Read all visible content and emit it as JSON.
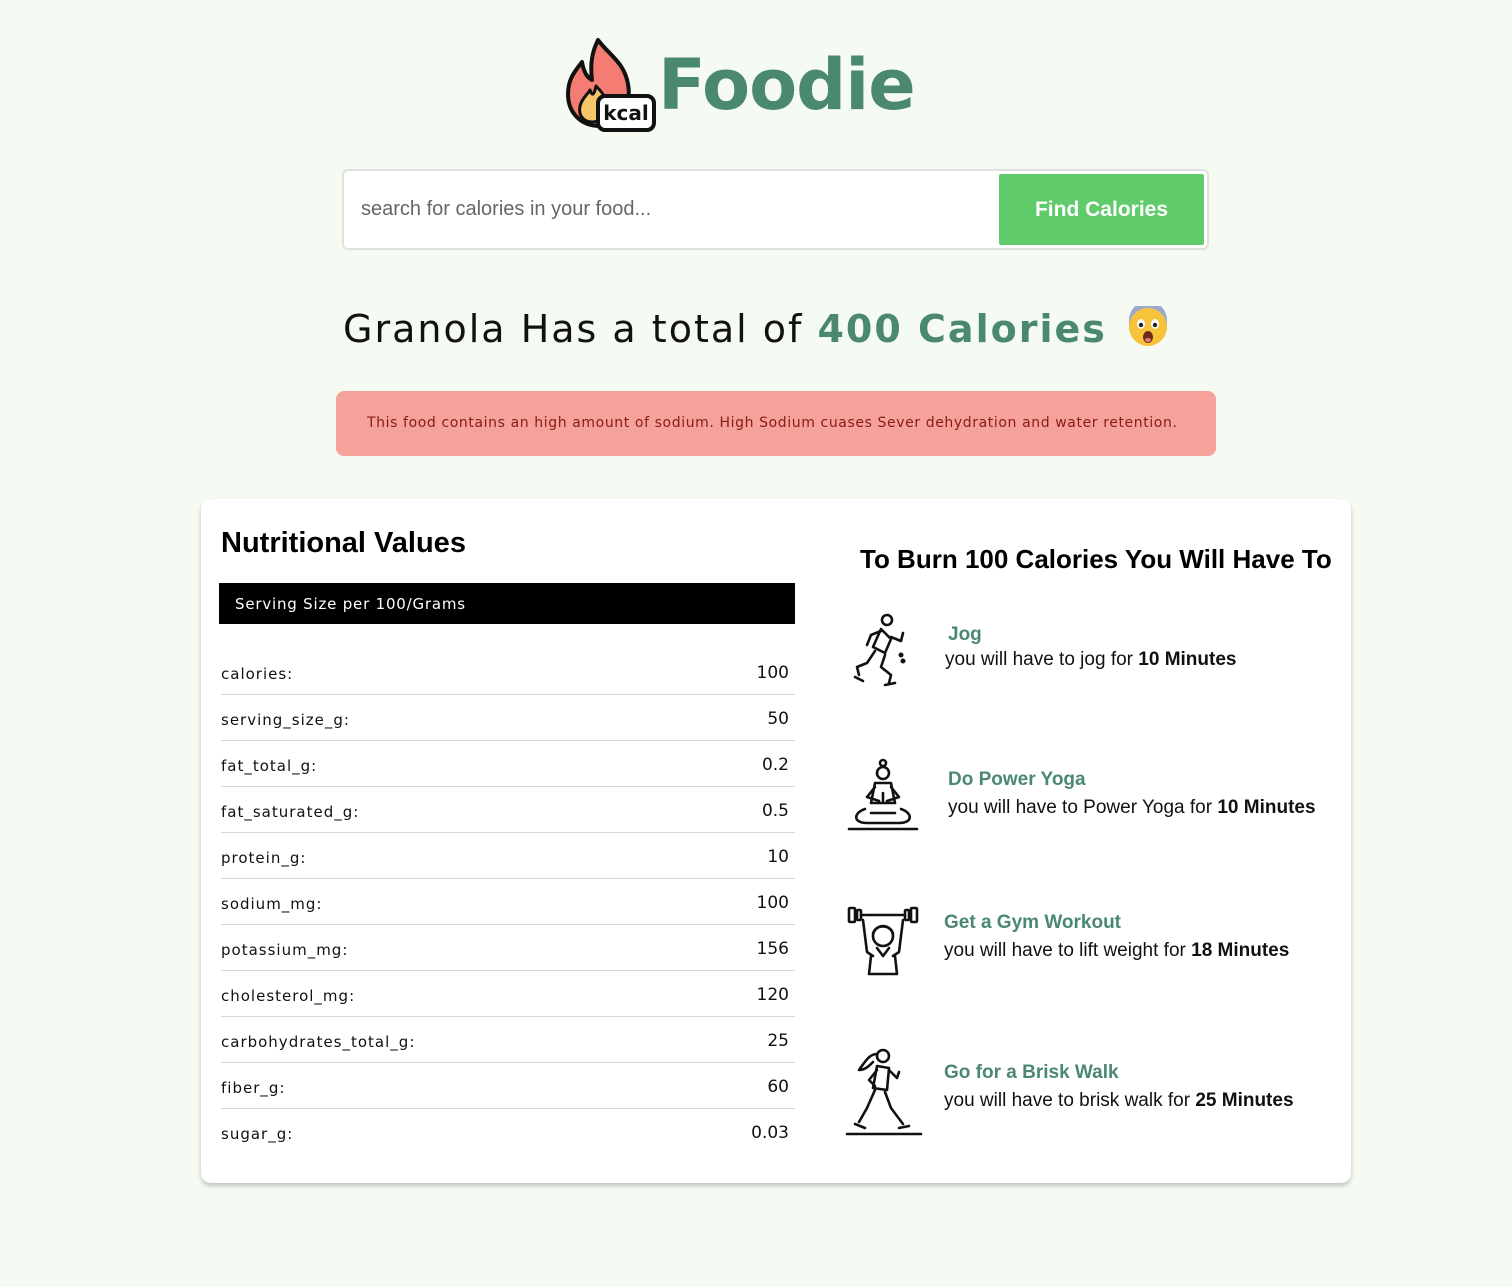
{
  "brand": {
    "name": "Foodie",
    "badge_text": "kcal",
    "color": "#4a8870"
  },
  "search": {
    "placeholder": "search for calories in your food...",
    "value": "",
    "button_label": "Find Calories",
    "button_color": "#5fcb6b"
  },
  "headline": {
    "food": "Granola",
    "middle": "Has a total of",
    "calories": "400 Calories",
    "emoji": "😨"
  },
  "alert": {
    "text": "This food contains an high amount of sodium. High Sodium cuases Sever dehydration and water retention.",
    "background": "#f6a29c"
  },
  "nutrition": {
    "title": "Nutritional Values",
    "serving_label": "Serving Size per 100/Grams",
    "rows": [
      {
        "key": "calories:",
        "value": "100"
      },
      {
        "key": "serving_size_g:",
        "value": "50"
      },
      {
        "key": "fat_total_g:",
        "value": "0.2"
      },
      {
        "key": "fat_saturated_g:",
        "value": "0.5"
      },
      {
        "key": "protein_g:",
        "value": "10"
      },
      {
        "key": "sodium_mg:",
        "value": "100"
      },
      {
        "key": "potassium_mg:",
        "value": "156"
      },
      {
        "key": "cholesterol_mg:",
        "value": "120"
      },
      {
        "key": "carbohydrates_total_g:",
        "value": "25"
      },
      {
        "key": "fiber_g:",
        "value": "60"
      },
      {
        "key": "sugar_g:",
        "value": "0.03"
      }
    ]
  },
  "burn": {
    "title": "To Burn 100 Calories You Will Have To",
    "activities": [
      {
        "icon": "runner-icon",
        "name": "Jog",
        "desc_prefix": "you will have to jog for",
        "duration": "10 Minutes"
      },
      {
        "icon": "yoga-icon",
        "name": "Do Power Yoga",
        "desc_prefix": "you will have to Power Yoga for",
        "duration": "10 Minutes"
      },
      {
        "icon": "weightlifting-icon",
        "name": "Get a Gym Workout",
        "desc_prefix": "you will have to lift weight for",
        "duration": "18 Minutes"
      },
      {
        "icon": "walking-icon",
        "name": "Go for a Brisk Walk",
        "desc_prefix": "you will have to brisk walk for",
        "duration": "25 Minutes"
      }
    ]
  }
}
